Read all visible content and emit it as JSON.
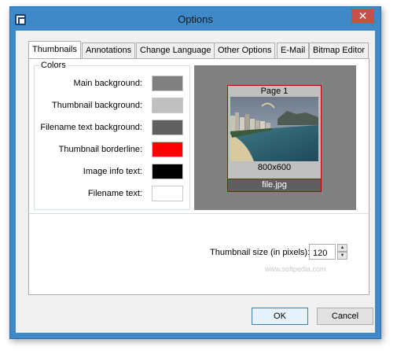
{
  "window": {
    "title": "Options",
    "close_glyph": "✕"
  },
  "tabs": [
    {
      "label": "Thumbnails",
      "active": true
    },
    {
      "label": "Annotations"
    },
    {
      "label": "Change Language"
    },
    {
      "label": "Other Options"
    },
    {
      "label": "E-Mail"
    },
    {
      "label": "Bitmap Editor"
    }
  ],
  "colors": {
    "legend": "Colors",
    "rows": [
      {
        "label": "Main background:",
        "color": "#808080"
      },
      {
        "label": "Thumbnail background:",
        "color": "#c0c0c0"
      },
      {
        "label": "Filename text background:",
        "color": "#606060"
      },
      {
        "label": "Thumbnail borderline:",
        "color": "#ff0000"
      },
      {
        "label": "Image info text:",
        "color": "#000000"
      },
      {
        "label": "Filename text:",
        "color": "#ffffff"
      }
    ]
  },
  "preview": {
    "page_label": "Page 1",
    "dimensions": "800x600",
    "filename": "file.jpg"
  },
  "thumbnail_size": {
    "label": "Thumbnail size (in pixels):",
    "value": "120"
  },
  "watermark": "www.softpedia.com",
  "buttons": {
    "ok": "OK",
    "cancel": "Cancel"
  }
}
